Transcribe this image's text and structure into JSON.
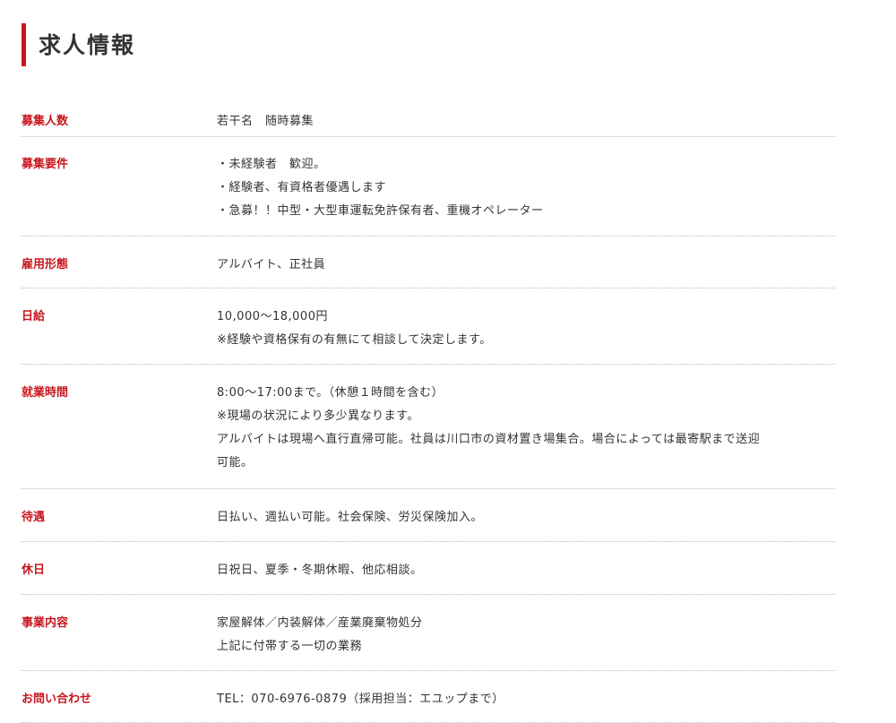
{
  "title": "求人情報",
  "accent_color": "#c8161e",
  "rows": [
    {
      "label": "募集人数",
      "lines": [
        "若干名　随時募集"
      ]
    },
    {
      "label": "募集要件",
      "lines": [
        "・未経験者　歓迎。",
        "・経験者、有資格者優遇します",
        "・急募！！中型・大型車運転免許保有者、重機オペレーター"
      ]
    },
    {
      "label": "雇用形態",
      "lines": [
        "アルバイト、正社員"
      ]
    },
    {
      "label": "日給",
      "lines": [
        "10,000～18,000円",
        "※経験や資格保有の有無にて相談して決定します。"
      ]
    },
    {
      "label": "就業時間",
      "lines": [
        "8:00～17:00まで。（休憩１時間を含む）",
        "※現場の状況により多少異なります。",
        "アルバイトは現場へ直行直帰可能。社員は川口市の資材置き場集合。場合によっては最寄駅まで送迎",
        "可能。"
      ]
    },
    {
      "label": "待遇",
      "lines": [
        "日払い、週払い可能。社会保険、労災保険加入。"
      ]
    },
    {
      "label": "休日",
      "lines": [
        "日祝日、夏季・冬期休暇、他応相談。"
      ]
    },
    {
      "label": "事業内容",
      "lines": [
        "家屋解体／内装解体／産業廃棄物処分",
        "上記に付帯する一切の業務"
      ]
    },
    {
      "label": "お問い合わせ",
      "lines": [
        "TEL：070-6976-0879（採用担当：エユップまで）"
      ]
    }
  ]
}
